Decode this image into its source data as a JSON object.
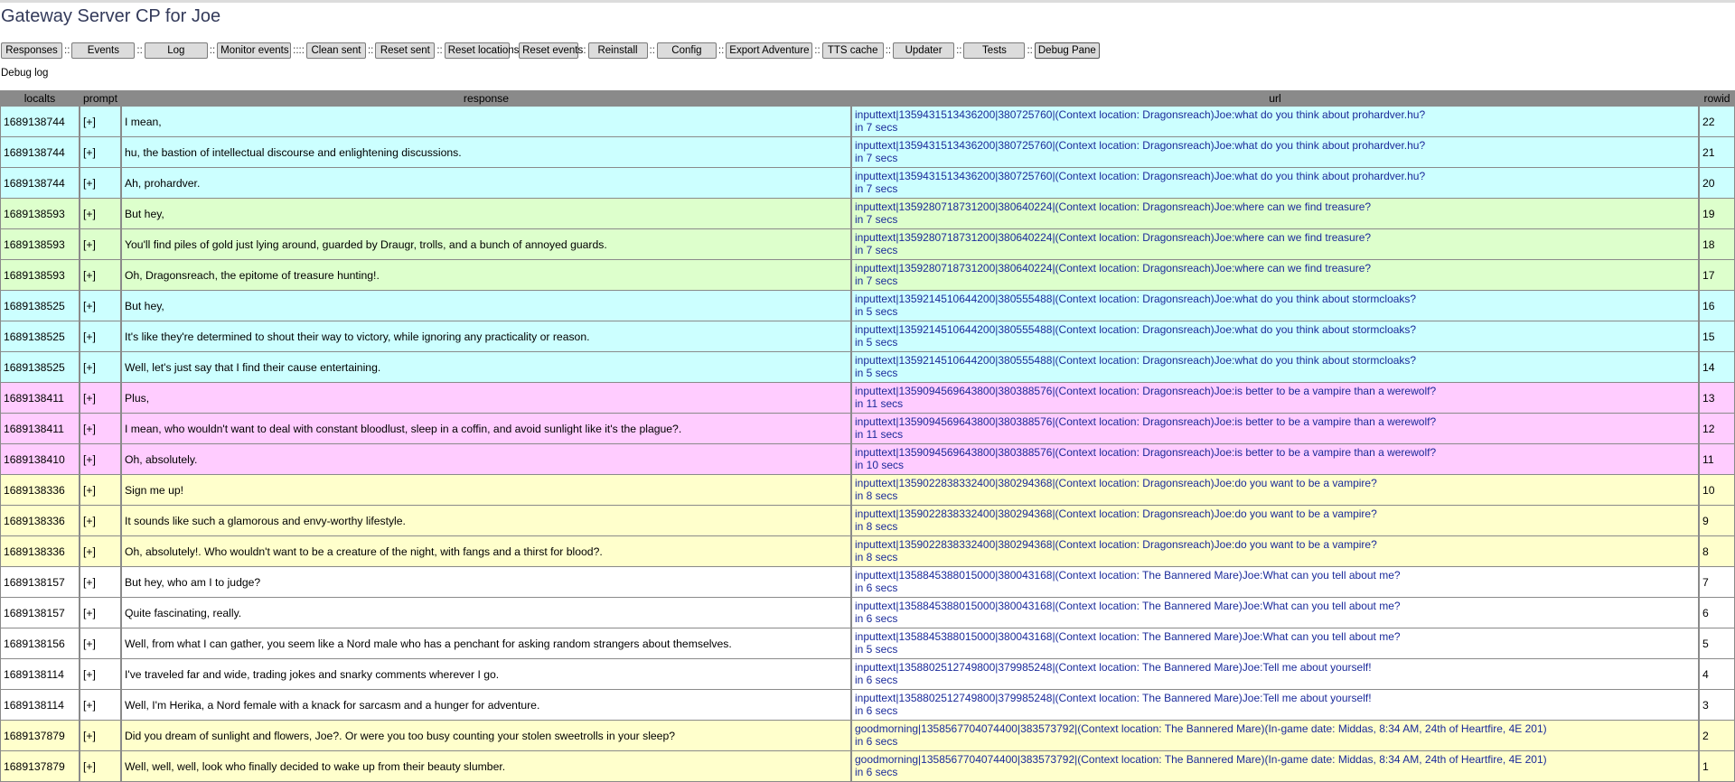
{
  "title": "Gateway Server CP for Joe",
  "toolbar": {
    "buttons": [
      {
        "label": "Responses"
      },
      {
        "label": "Events"
      },
      {
        "label": "Log"
      },
      {
        "label": "Monitor events"
      },
      {
        "label": "Clean sent"
      },
      {
        "label": "Reset sent"
      },
      {
        "label": "Reset locations"
      },
      {
        "label": "Reset events"
      },
      {
        "label": "Reinstall"
      },
      {
        "label": "Config"
      },
      {
        "label": "Export Adventure"
      },
      {
        "label": "TTS cache"
      },
      {
        "label": "Updater"
      },
      {
        "label": "Tests"
      },
      {
        "label": "Debug Pane"
      }
    ],
    "separators": [
      "::",
      "::",
      "::",
      "::::",
      "::",
      "::",
      "::",
      "::",
      "::",
      "::",
      "::",
      "::",
      "::",
      "::"
    ]
  },
  "subtitle": "Debug log",
  "table": {
    "headers": [
      "localts",
      "prompt",
      "response",
      "url",
      "rowid"
    ],
    "rows": [
      {
        "localts": "1689138744",
        "prompt": "[+]",
        "response": "I mean,",
        "url": "inputtext|1359431513436200|380725760|(Context location: Dragonsreach)Joe:what do you think about prohardver.hu?",
        "time": "in 7 secs",
        "rowid": "22",
        "group": "g1"
      },
      {
        "localts": "1689138744",
        "prompt": "[+]",
        "response": "hu, the bastion of intellectual discourse and enlightening discussions.",
        "url": "inputtext|1359431513436200|380725760|(Context location: Dragonsreach)Joe:what do you think about prohardver.hu?",
        "time": "in 7 secs",
        "rowid": "21",
        "group": "g1"
      },
      {
        "localts": "1689138744",
        "prompt": "[+]",
        "response": "Ah, prohardver.",
        "url": "inputtext|1359431513436200|380725760|(Context location: Dragonsreach)Joe:what do you think about prohardver.hu?",
        "time": "in 7 secs",
        "rowid": "20",
        "group": "g1"
      },
      {
        "localts": "1689138593",
        "prompt": "[+]",
        "response": "But hey,",
        "url": "inputtext|1359280718731200|380640224|(Context location: Dragonsreach)Joe:where can we find treasure?",
        "time": "in 7 secs",
        "rowid": "19",
        "group": "g2"
      },
      {
        "localts": "1689138593",
        "prompt": "[+]",
        "response": "You'll find piles of gold just lying around, guarded by Draugr, trolls, and a bunch of annoyed guards.",
        "url": "inputtext|1359280718731200|380640224|(Context location: Dragonsreach)Joe:where can we find treasure?",
        "time": "in 7 secs",
        "rowid": "18",
        "group": "g2"
      },
      {
        "localts": "1689138593",
        "prompt": "[+]",
        "response": "Oh, Dragonsreach, the epitome of treasure hunting!.",
        "url": "inputtext|1359280718731200|380640224|(Context location: Dragonsreach)Joe:where can we find treasure?",
        "time": "in 7 secs",
        "rowid": "17",
        "group": "g2"
      },
      {
        "localts": "1689138525",
        "prompt": "[+]",
        "response": "But hey,",
        "url": "inputtext|1359214510644200|380555488|(Context location: Dragonsreach)Joe:what do you think about stormcloaks?",
        "time": "in 5 secs",
        "rowid": "16",
        "group": "g1"
      },
      {
        "localts": "1689138525",
        "prompt": "[+]",
        "response": "It's like they're determined to shout their way to victory, while ignoring any practicality or reason.",
        "url": "inputtext|1359214510644200|380555488|(Context location: Dragonsreach)Joe:what do you think about stormcloaks?",
        "time": "in 5 secs",
        "rowid": "15",
        "group": "g1"
      },
      {
        "localts": "1689138525",
        "prompt": "[+]",
        "response": "Well, let's just say that I find their cause entertaining.",
        "url": "inputtext|1359214510644200|380555488|(Context location: Dragonsreach)Joe:what do you think about stormcloaks?",
        "time": "in 5 secs",
        "rowid": "14",
        "group": "g1"
      },
      {
        "localts": "1689138411",
        "prompt": "[+]",
        "response": "Plus,",
        "url": "inputtext|1359094569643800|380388576|(Context location: Dragonsreach)Joe:is better to be a vampire than a werewolf?",
        "time": "in 11 secs",
        "rowid": "13",
        "group": "g3"
      },
      {
        "localts": "1689138411",
        "prompt": "[+]",
        "response": "I mean, who wouldn't want to deal with constant bloodlust, sleep in a coffin, and avoid sunlight like it's the plague?.",
        "url": "inputtext|1359094569643800|380388576|(Context location: Dragonsreach)Joe:is better to be a vampire than a werewolf?",
        "time": "in 11 secs",
        "rowid": "12",
        "group": "g3"
      },
      {
        "localts": "1689138410",
        "prompt": "[+]",
        "response": "Oh, absolutely.",
        "url": "inputtext|1359094569643800|380388576|(Context location: Dragonsreach)Joe:is better to be a vampire than a werewolf?",
        "time": "in 10 secs",
        "rowid": "11",
        "group": "g3"
      },
      {
        "localts": "1689138336",
        "prompt": "[+]",
        "response": "Sign me up!",
        "url": "inputtext|1359022838332400|380294368|(Context location: Dragonsreach)Joe:do you want to be a vampire?",
        "time": "in 8 secs",
        "rowid": "10",
        "group": "g4"
      },
      {
        "localts": "1689138336",
        "prompt": "[+]",
        "response": "It sounds like such a glamorous and envy-worthy lifestyle.",
        "url": "inputtext|1359022838332400|380294368|(Context location: Dragonsreach)Joe:do you want to be a vampire?",
        "time": "in 8 secs",
        "rowid": "9",
        "group": "g4"
      },
      {
        "localts": "1689138336",
        "prompt": "[+]",
        "response": "Oh, absolutely!. Who wouldn't want to be a creature of the night, with fangs and a thirst for blood?.",
        "url": "inputtext|1359022838332400|380294368|(Context location: Dragonsreach)Joe:do you want to be a vampire?",
        "time": "in 8 secs",
        "rowid": "8",
        "group": "g4"
      },
      {
        "localts": "1689138157",
        "prompt": "[+]",
        "response": "But hey, who am I to judge?",
        "url": "inputtext|1358845388015000|380043168|(Context location: The Bannered Mare)Joe:What can you tell about me?",
        "time": "in 6 secs",
        "rowid": "7",
        "group": "g5"
      },
      {
        "localts": "1689138157",
        "prompt": "[+]",
        "response": "Quite fascinating, really.",
        "url": "inputtext|1358845388015000|380043168|(Context location: The Bannered Mare)Joe:What can you tell about me?",
        "time": "in 6 secs",
        "rowid": "6",
        "group": "g5"
      },
      {
        "localts": "1689138156",
        "prompt": "[+]",
        "response": "Well, from what I can gather, you seem like a Nord male who has a penchant for asking random strangers about themselves.",
        "url": "inputtext|1358845388015000|380043168|(Context location: The Bannered Mare)Joe:What can you tell about me?",
        "time": "in 5 secs",
        "rowid": "5",
        "group": "g5"
      },
      {
        "localts": "1689138114",
        "prompt": "[+]",
        "response": "I've traveled far and wide, trading jokes and snarky comments wherever I go.",
        "url": "inputtext|1358802512749800|379985248|(Context location: The Bannered Mare)Joe:Tell me about yourself!",
        "time": "in 6 secs",
        "rowid": "4",
        "group": "g5"
      },
      {
        "localts": "1689138114",
        "prompt": "[+]",
        "response": "Well, I'm Herika, a Nord female with a knack for sarcasm and a hunger for adventure.",
        "url": "inputtext|1358802512749800|379985248|(Context location: The Bannered Mare)Joe:Tell me about yourself!",
        "time": "in 6 secs",
        "rowid": "3",
        "group": "g5"
      },
      {
        "localts": "1689137879",
        "prompt": "[+]",
        "response": "Did you dream of sunlight and flowers, Joe?. Or were you too busy counting your stolen sweetrolls in your sleep?",
        "url": "goodmorning|1358567704074400|383573792|(Context location: The Bannered Mare)(In-game date: Middas, 8:34 AM, 24th of Heartfire, 4E 201)",
        "time": "in 6 secs",
        "rowid": "2",
        "group": "g4"
      },
      {
        "localts": "1689137879",
        "prompt": "[+]",
        "response": "Well, well, well, look who finally decided to wake up from their beauty slumber.",
        "url": "goodmorning|1358567704074400|383573792|(Context location: The Bannered Mare)(In-game date: Middas, 8:34 AM, 24th of Heartfire, 4E 201)",
        "time": "in 6 secs",
        "rowid": "1",
        "group": "g4"
      }
    ]
  }
}
